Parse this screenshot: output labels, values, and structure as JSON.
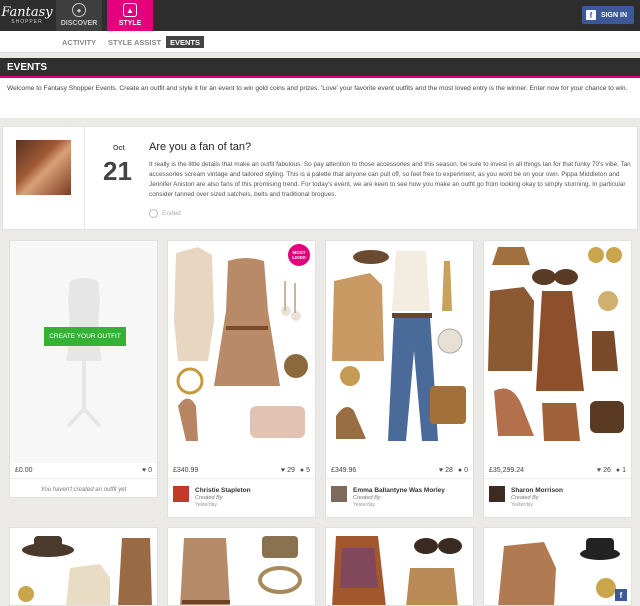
{
  "topbar": {
    "logo_line1": "Fantasy",
    "logo_line2": "SHOPPER",
    "nav": [
      {
        "label": "DISCOVER",
        "icon": "map-pin-icon"
      },
      {
        "label": "STYLE",
        "icon": "hanger-icon"
      }
    ],
    "signin_label": "SIGN IN",
    "signin_icon": "facebook-icon"
  },
  "subnav": {
    "tabs": [
      "ACTIVITY",
      "STYLE ASSIST",
      "EVENTS"
    ],
    "active": "EVENTS"
  },
  "events": {
    "heading": "EVENTS",
    "intro": "Welcome to Fantasy Shopper Events. Create an outfit and style it for an event to win gold coins and prizes. 'Love' your favorite event outfits and the most loved entry is the winner. Enter now for your chance to win."
  },
  "event": {
    "month": "Oct",
    "day": "21",
    "title": "Are you a fan of tan?",
    "description": "It really is the little details that make an outfit fabulous. So pay attention to those accessories and this season, be sure to invest in all things tan for that funky 70's vibe. Tan accessories scream vintage and tailored styling. This is a palette that anyone can pull off, so feel free to experiment, as you wont be on your own. Pippa Middleton and Jennifer Aniston are also fans of this promising trend. For today's event, we are keen to see how you make an outfit go from looking okay to simply stunning. In particular consider tanned over sized satchels, belts and traditional brogues.",
    "status": "Ended"
  },
  "create_card": {
    "button_label": "CREATE YOUR OUTFIT",
    "price": "£0.00",
    "likes": "0",
    "note": "You haven't created an outfit yet"
  },
  "outfits": [
    {
      "price": "£340.99",
      "likes": "29",
      "comments": "5",
      "author": "Christie Stapleton",
      "created_by": "Created By",
      "when": "Yesterday",
      "badge": "MOST LIKED"
    },
    {
      "price": "£349.96",
      "likes": "28",
      "comments": "0",
      "author": "Emma Ballantyne Was Morley",
      "created_by": "Created By",
      "when": "Yesterday"
    },
    {
      "price": "£35,299.24",
      "likes": "26",
      "comments": "1",
      "author": "Sharon Morrison",
      "created_by": "Created By",
      "when": "Yesterday"
    }
  ],
  "colors": {
    "brand_pink": "#e4007c",
    "create_green": "#34b233",
    "facebook_blue": "#3b5998"
  }
}
